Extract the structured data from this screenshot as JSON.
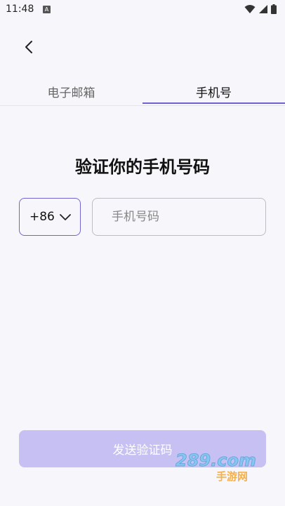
{
  "status_bar": {
    "time": "11:48",
    "notification_icon": "A"
  },
  "tabs": [
    {
      "label": "电子邮箱",
      "active": false
    },
    {
      "label": "手机号",
      "active": true
    }
  ],
  "title": "验证你的手机号码",
  "country_code": "+86",
  "phone_input": {
    "placeholder": "手机号码",
    "value": ""
  },
  "send_button": {
    "label": "发送验证码"
  },
  "watermark": {
    "logo": "289.com",
    "text": "手游网"
  },
  "colors": {
    "accent": "#6f63d4",
    "button_disabled": "#c6c0f3",
    "background": "#f7f6fa"
  }
}
